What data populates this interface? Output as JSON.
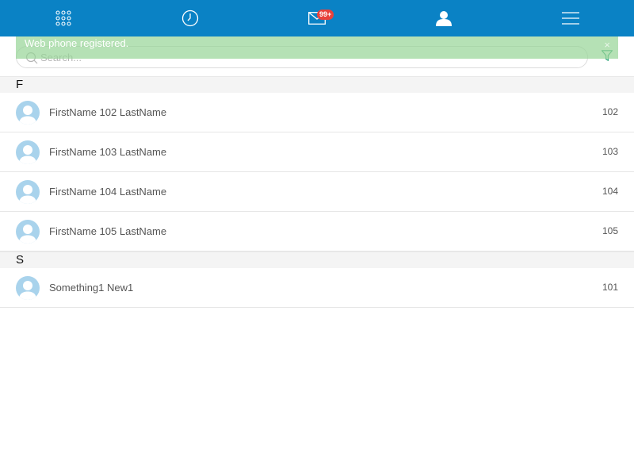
{
  "nav": {
    "items": [
      {
        "icon": "dialpad-icon"
      },
      {
        "icon": "clock-icon"
      },
      {
        "icon": "mail-icon",
        "badge": "99+"
      },
      {
        "icon": "user-icon"
      },
      {
        "icon": "menu-icon"
      }
    ],
    "color": "#0a82c5"
  },
  "toast": {
    "text": "Web phone registered.",
    "close": "×"
  },
  "search": {
    "placeholder": "Search..."
  },
  "contacts": {
    "sections": [
      {
        "letter": "F",
        "rows": [
          {
            "name": "FirstName 102 LastName",
            "ext": "102"
          },
          {
            "name": "FirstName 103 LastName",
            "ext": "103"
          },
          {
            "name": "FirstName 104 LastName",
            "ext": "104"
          },
          {
            "name": "FirstName 105 LastName",
            "ext": "105"
          }
        ]
      },
      {
        "letter": "S",
        "rows": [
          {
            "name": "Something1 New1",
            "ext": "101"
          }
        ]
      }
    ]
  }
}
